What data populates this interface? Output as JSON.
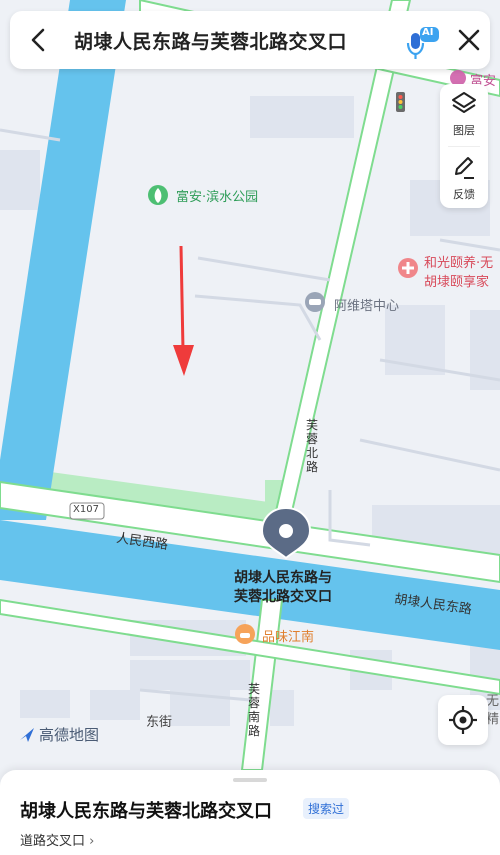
{
  "search": {
    "query": "胡埭人民东路与芙蓉北路交叉口",
    "ai_badge": "AI"
  },
  "tools": {
    "layers_label": "图层",
    "feedback_label": "反馈"
  },
  "map": {
    "park_label": "富安·滨水公园",
    "ave_center": "阿维塔中心",
    "hospital_label_1": "和光颐养·无",
    "hospital_label_2": "胡埭颐享家",
    "pin_label_1": "胡埭人民东路与",
    "pin_label_2": "芙蓉北路交叉口",
    "restaurant_label": "品味江南",
    "road_renmin_west": "人民西路",
    "road_renmin_east": "胡埭人民东路",
    "road_furong_north": "芙蓉北路",
    "road_furong_south": "芙蓉南路",
    "road_x107": "X107",
    "street_east": "东街",
    "partial_top_right": "富安",
    "partial_right_1": "无",
    "partial_right_2": "精"
  },
  "logo": {
    "text": "高德地图"
  },
  "sheet": {
    "title": "胡埭人民东路与芙蓉北路交叉口",
    "badge": "搜索过",
    "subtitle": "道路交叉口",
    "chevron": "›"
  },
  "colors": {
    "accent": "#2f6fd6",
    "water": "#65c3ed",
    "road_green": "#7fdc8f",
    "arrow": "#ef3b3b",
    "pin": "#5b6b86"
  }
}
